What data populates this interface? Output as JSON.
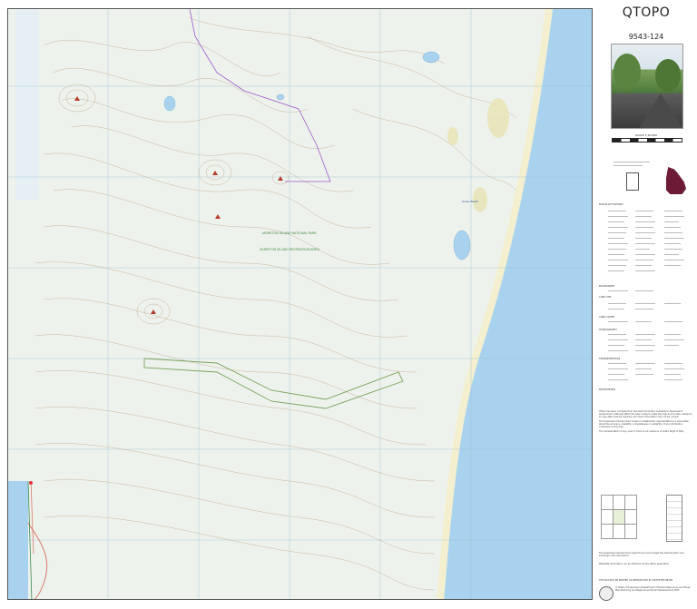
{
  "brand": "QTOPO",
  "sheet_number": "9543-124",
  "scale_label": "SCALE 1:10,000",
  "map_labels": {
    "park_name": "MORETON ISLAND NATIONAL PARK",
    "recreation_area": "MORETON ISLAND RECREATION AREA",
    "beach_label": "Ocean Beach"
  },
  "legend_sections": [
    "ROADS OF HIGHWAY",
    "BOUNDARIES",
    "LAND USE",
    "LAND COVER",
    "HYDROGRAPHY",
    "TRANSPORTATION",
    "BATHYMETRIC"
  ],
  "notes": {
    "disclaimer_1": "QTopo has been compiled from the best information available to Queensland Government. Although effort has been made to make the map as accurate, reference to map data must be checked, and some information may not be current.",
    "disclaimer_2": "The Queensland Government makes no statements, representations or warranties about the accuracy, reliability, completeness or suitability of any information contained on this map.",
    "disclaimer_3": "The representation of any road or track is not evidence of public Right of Way.",
    "support": "The Queensland Government supports and encourages the dissemination and exchange of its information.",
    "metadata": "Metadata information can be obtained via the QTopo application",
    "reproduction": "THIS MAP MAY BE PRINTED OR REPRODUCED BY WHATEVER MEANS",
    "copyright": "© State of Queensland (Department of Natural Resources and Mines, Manufacturing and Regional and Rural Development) 2025"
  },
  "colors": {
    "ocean": "#a9d2ee",
    "land": "#eef2ec",
    "sand": "#f3efcf",
    "contour": "#b9a48a",
    "grid": "#9cc0d4",
    "boundary": "#9b5bd0",
    "road": "#d97a6e",
    "qld_fill": "#6d1a36"
  }
}
